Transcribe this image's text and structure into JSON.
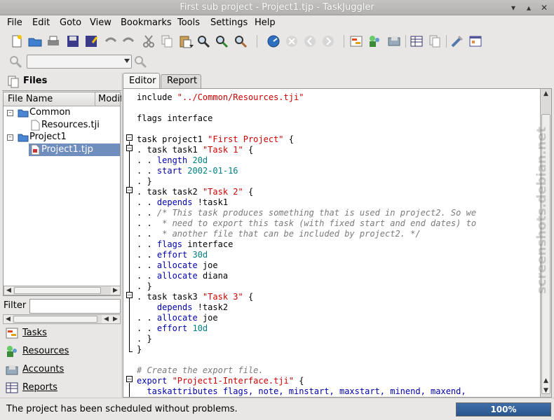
{
  "window": {
    "title": "First sub project - Project1.tjp - TaskJuggler"
  },
  "menu": [
    "File",
    "Edit",
    "Goto",
    "View",
    "Bookmarks",
    "Tools",
    "Settings",
    "Help"
  ],
  "left_panel": {
    "files_tab": "Files",
    "tree_headers": [
      "File Name",
      "Modifi"
    ],
    "tree": [
      {
        "label": "Common",
        "level": 0,
        "expanded": true
      },
      {
        "label": "Resources.tji",
        "level": 1
      },
      {
        "label": "Project1",
        "level": 0,
        "expanded": true
      },
      {
        "label": "Project1.tjp",
        "level": 1,
        "selected": true
      }
    ],
    "filter_label": "Filter",
    "filter_value": "",
    "nav": [
      "Tasks",
      "Resources",
      "Accounts",
      "Reports"
    ]
  },
  "tabs": [
    "Editor",
    "Report"
  ],
  "active_tab": "Editor",
  "code_lines": [
    [
      [
        "include ",
        "kw"
      ],
      [
        "\"../Common/Resources.tji\"",
        "st"
      ]
    ],
    [],
    [
      [
        "flags interface",
        "kw"
      ]
    ],
    [],
    [
      [
        "task project1 ",
        "kw"
      ],
      [
        "\"First Project\"",
        "st"
      ],
      [
        " {",
        "kw"
      ]
    ],
    [
      [
        ". ",
        "kw"
      ],
      [
        "task task1 ",
        "kw"
      ],
      [
        "\"Task 1\"",
        "st"
      ],
      [
        " {",
        "kw"
      ]
    ],
    [
      [
        ". . ",
        "kw"
      ],
      [
        "length ",
        "at"
      ],
      [
        "20d",
        "nm"
      ]
    ],
    [
      [
        ". . ",
        "kw"
      ],
      [
        "start ",
        "at"
      ],
      [
        "2002-01-16",
        "nm"
      ]
    ],
    [
      [
        ". }",
        "kw"
      ]
    ],
    [
      [
        ". ",
        "kw"
      ],
      [
        "task task2 ",
        "kw"
      ],
      [
        "\"Task 2\"",
        "st"
      ],
      [
        " {",
        "kw"
      ]
    ],
    [
      [
        ". . ",
        "kw"
      ],
      [
        "depends ",
        "at"
      ],
      [
        "!task1",
        "kw"
      ]
    ],
    [
      [
        ". . ",
        "kw"
      ],
      [
        "/* This task produces something that is used in project2. So we",
        "cm"
      ]
    ],
    [
      [
        ". .  ",
        "kw"
      ],
      [
        "* need to export this task (with fixed start and end dates) to",
        "cm"
      ]
    ],
    [
      [
        ". .  ",
        "kw"
      ],
      [
        "* another file that can be included by project2. */",
        "cm"
      ]
    ],
    [
      [
        ". . ",
        "kw"
      ],
      [
        "flags ",
        "at"
      ],
      [
        "interface",
        "kw"
      ]
    ],
    [
      [
        ". . ",
        "kw"
      ],
      [
        "effort ",
        "at"
      ],
      [
        "30d",
        "nm"
      ]
    ],
    [
      [
        ". . ",
        "kw"
      ],
      [
        "allocate ",
        "at"
      ],
      [
        "joe",
        "kw"
      ]
    ],
    [
      [
        ". . ",
        "kw"
      ],
      [
        "allocate ",
        "at"
      ],
      [
        "diana",
        "kw"
      ]
    ],
    [
      [
        ". }",
        "kw"
      ]
    ],
    [
      [
        ". ",
        "kw"
      ],
      [
        "task task3 ",
        "kw"
      ],
      [
        "\"Task 3\"",
        "st"
      ],
      [
        " {",
        "kw"
      ]
    ],
    [
      [
        "    ",
        "kw"
      ],
      [
        "depends ",
        "at"
      ],
      [
        "!task2",
        "kw"
      ]
    ],
    [
      [
        ". . ",
        "kw"
      ],
      [
        "allocate ",
        "at"
      ],
      [
        "joe",
        "kw"
      ]
    ],
    [
      [
        ". . ",
        "kw"
      ],
      [
        "effort ",
        "at"
      ],
      [
        "10d",
        "nm"
      ]
    ],
    [
      [
        ". }",
        "kw"
      ]
    ],
    [
      [
        "}",
        "kw"
      ]
    ],
    [],
    [
      [
        "# Create the export file.",
        "cm"
      ]
    ],
    [
      [
        "export ",
        "at"
      ],
      [
        "\"Project1-Interface.tji\"",
        "st"
      ],
      [
        " {",
        "kw"
      ]
    ],
    [
      [
        "  taskattributes flags, note, minstart, maxstart, minend, maxend,",
        "at"
      ]
    ]
  ],
  "status": {
    "message": "The project has been scheduled without problems.",
    "progress_label": "100%",
    "progress": 1.0
  },
  "watermark": "screenshots.debian.net",
  "colors": {
    "selection": "#6f8dbd",
    "progress": "#2f5f9a",
    "string": "#cc0000",
    "attribute": "#0000aa",
    "number": "#008080"
  }
}
